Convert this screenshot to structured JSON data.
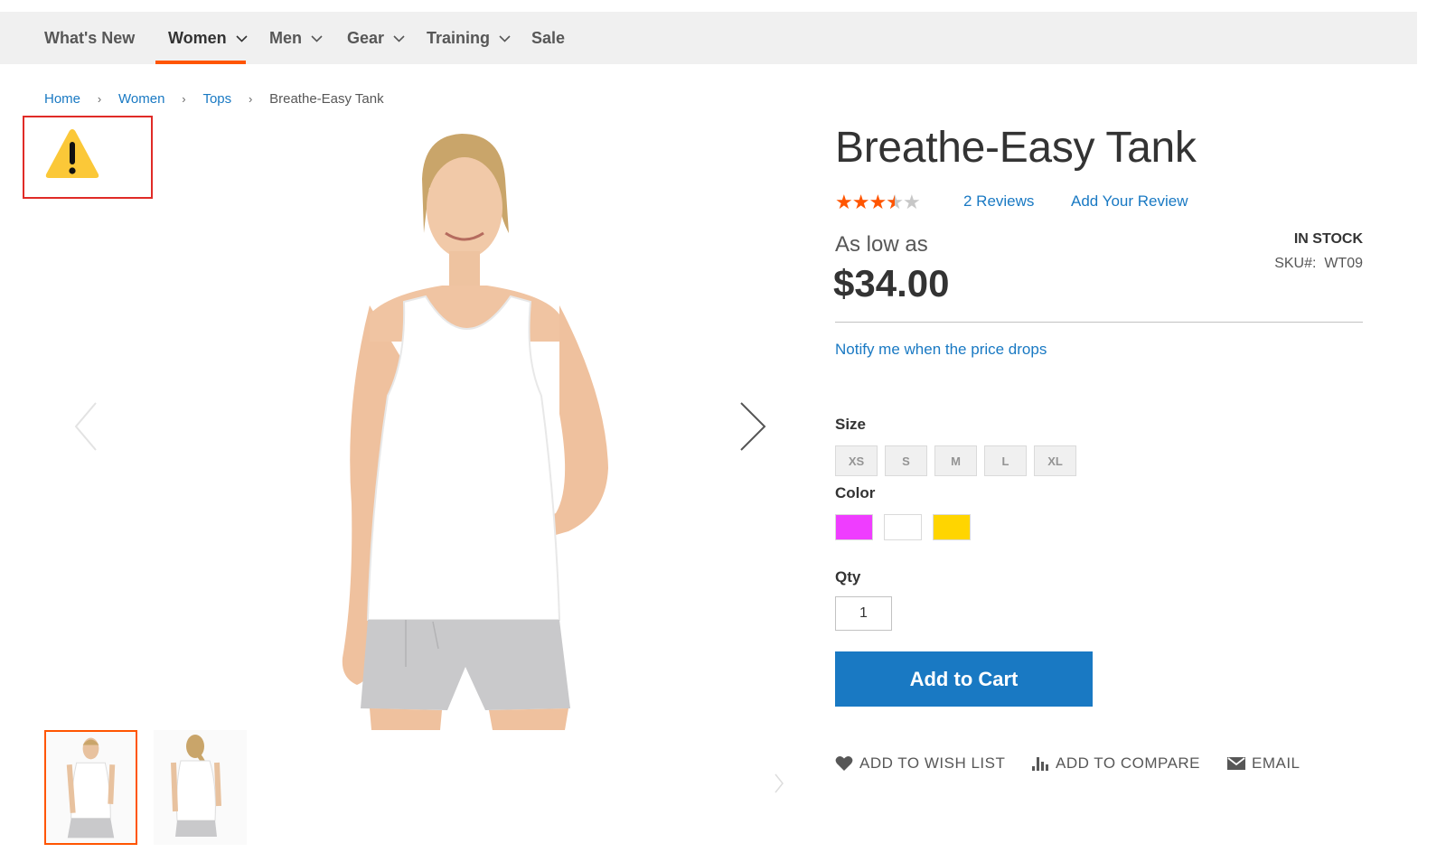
{
  "nav": {
    "items": [
      {
        "label": "What's New",
        "has_dropdown": false
      },
      {
        "label": "Women",
        "has_dropdown": true,
        "active": true
      },
      {
        "label": "Men",
        "has_dropdown": true
      },
      {
        "label": "Gear",
        "has_dropdown": true
      },
      {
        "label": "Training",
        "has_dropdown": true
      },
      {
        "label": "Sale",
        "has_dropdown": false
      }
    ],
    "accent_color": "#ff5501"
  },
  "breadcrumbs": [
    "Home",
    "Women",
    "Tops",
    "Breathe-Easy Tank"
  ],
  "alert": {
    "icon": "warning-icon",
    "highlight_color": "#e02b27"
  },
  "gallery": {
    "arrows": [
      "chevron-left-icon",
      "chevron-right-icon"
    ],
    "thumbnails": [
      "front view",
      "back view"
    ],
    "selected_thumbnail": 0
  },
  "product": {
    "title": "Breathe-Easy Tank",
    "rating": {
      "stars": 3.5,
      "max": 5
    },
    "reviews_label": "2  Reviews",
    "add_review_label": "Add Your Review",
    "price_prefix": "As low as",
    "price": "$34.00",
    "stock": "IN STOCK",
    "sku_label": "SKU#:",
    "sku": "WT09",
    "notify_label": "Notify me when the price drops"
  },
  "options": {
    "size_label": "Size",
    "sizes": [
      "XS",
      "S",
      "M",
      "L",
      "XL"
    ],
    "color_label": "Color",
    "colors": [
      "#ef3dff",
      "#ffffff",
      "#ffd500"
    ],
    "qty_label": "Qty",
    "qty_value": "1"
  },
  "cart": {
    "label": "Add to Cart",
    "color": "#1979c3"
  },
  "actions": [
    {
      "label": "ADD TO WISH LIST",
      "icon": "heart-icon"
    },
    {
      "label": "ADD TO COMPARE",
      "icon": "compare-icon"
    },
    {
      "label": "EMAIL",
      "icon": "envelope-icon"
    }
  ]
}
